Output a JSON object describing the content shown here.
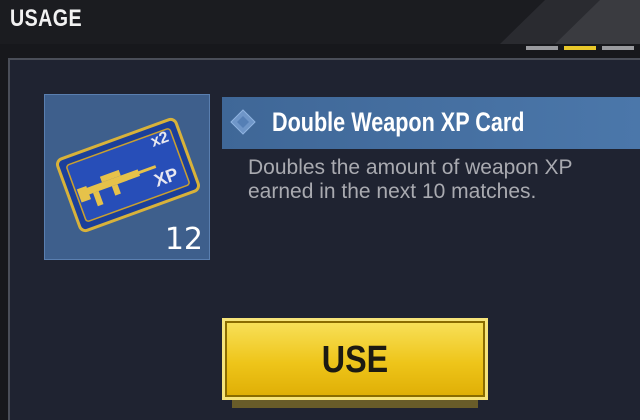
{
  "header": {
    "title": "USAGE"
  },
  "pager": {
    "count": 3,
    "active": 2
  },
  "item": {
    "name": "Double Weapon XP Card",
    "description": "Doubles the amount of weapon XP earned in the next 10 matches.",
    "quantity": "12",
    "card_multiplier": "x2",
    "card_label": "XP"
  },
  "actions": {
    "use_label": "USE"
  },
  "colors": {
    "accent": "#e9c82a",
    "name_bar": "#4b77aa",
    "tile": "#3e5f8c",
    "button": "#eec51a"
  }
}
